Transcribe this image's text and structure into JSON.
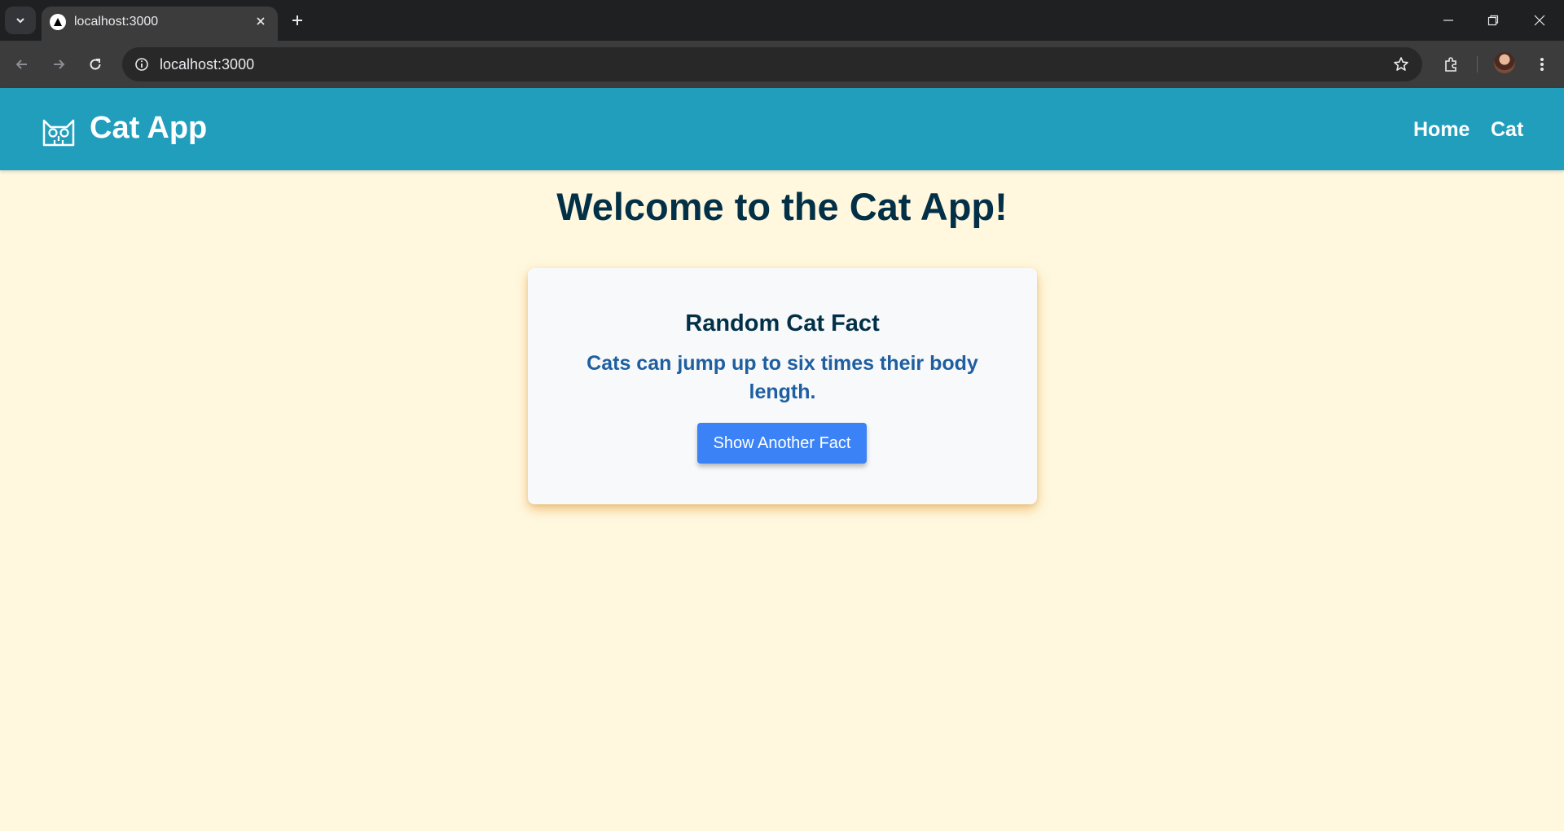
{
  "browser": {
    "tab_title": "localhost:3000",
    "url": "localhost:3000"
  },
  "header": {
    "brand": "Cat App",
    "nav": [
      {
        "label": "Home"
      },
      {
        "label": "Cat"
      }
    ],
    "color": "#219ebc"
  },
  "main": {
    "title": "Welcome to the Cat App!",
    "card": {
      "title": "Random Cat Fact",
      "fact": "Cats can jump up to six times their body length.",
      "button_label": "Show Another Fact"
    }
  },
  "colors": {
    "background": "#fff8df",
    "heading": "#023047",
    "fact_text": "#1f5fa0",
    "button": "#3b82f6"
  }
}
